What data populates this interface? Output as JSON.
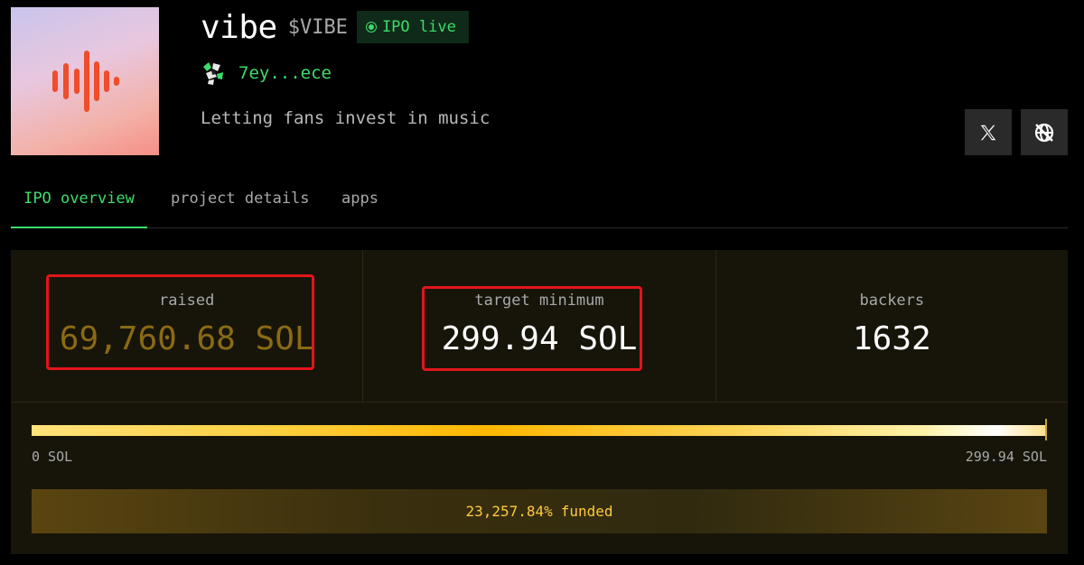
{
  "project": {
    "name": "vibe",
    "ticker": "$VIBE",
    "status_badge": "IPO live",
    "creator_address": "7ey...ece",
    "description": "Letting fans invest in music"
  },
  "social": {
    "x_icon": "x-logo-icon",
    "website_icon": "globe-crossed-icon"
  },
  "tabs": [
    {
      "label": "IPO overview",
      "active": true
    },
    {
      "label": "project details",
      "active": false
    },
    {
      "label": "apps",
      "active": false
    }
  ],
  "stats": {
    "raised": {
      "label": "raised",
      "value": "69,760.68 SOL"
    },
    "target": {
      "label": "target minimum",
      "value": "299.94 SOL"
    },
    "backers": {
      "label": "backers",
      "value": "1632"
    }
  },
  "progress": {
    "min_label": "0 SOL",
    "max_label": "299.94 SOL",
    "fill_fraction": 1.0,
    "funded_percent": "23,257.84%",
    "funded_word": "funded"
  },
  "colors": {
    "accent_green": "#3ddc6b",
    "gold": "#ffc93d",
    "highlight_red": "#e4141b"
  }
}
